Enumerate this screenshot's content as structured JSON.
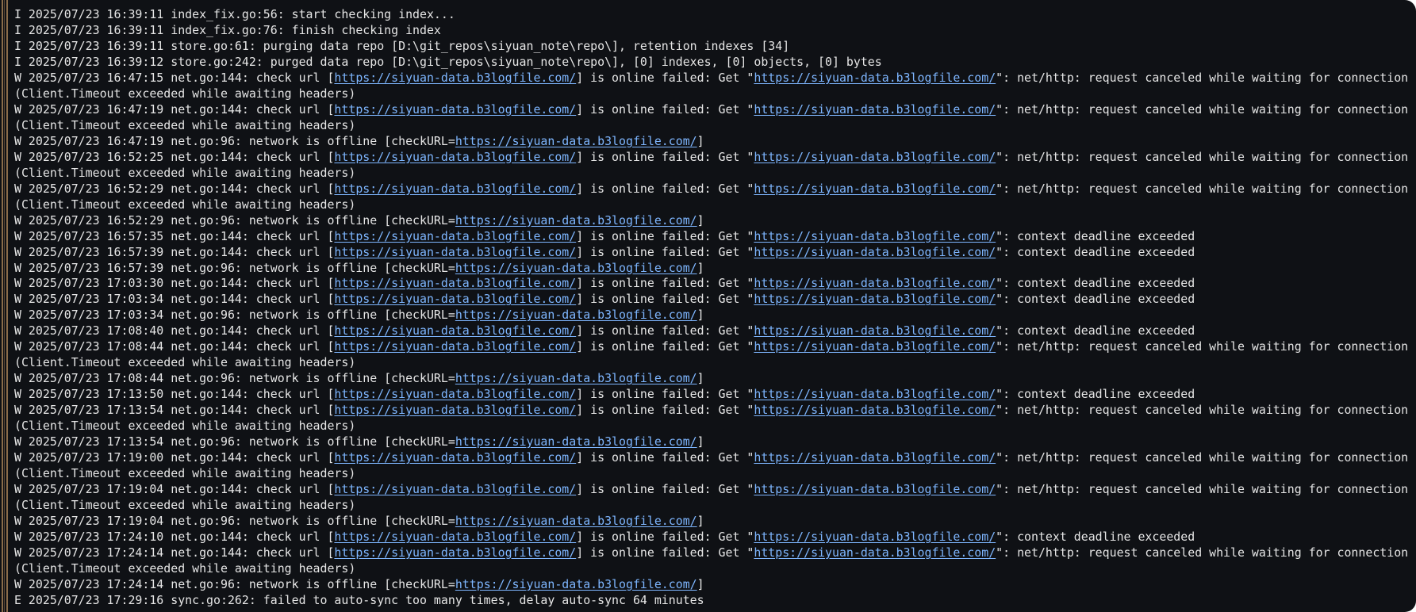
{
  "terminal": {
    "lines": [
      [
        "I 2025/07/23 16:39:11 index_fix.go:56: start checking index..."
      ],
      [
        "I 2025/07/23 16:39:11 index_fix.go:76: finish checking index"
      ],
      [
        "I 2025/07/23 16:39:11 store.go:61: purging data repo [D:\\git_repos\\siyuan_note\\repo\\], retention indexes [34]"
      ],
      [
        "I 2025/07/23 16:39:12 store.go:242: purged data repo [D:\\git_repos\\siyuan_note\\repo\\], [0] indexes, [0] objects, [0] bytes"
      ],
      [
        "W 2025/07/23 16:47:15 net.go:144: check url [",
        {
          "url": "https://siyuan-data.b3logfile.com/"
        },
        "] is online failed: Get \"",
        {
          "url": "https://siyuan-data.b3logfile.com/"
        },
        "\": net/http: request canceled while waiting for connection"
      ],
      [
        "(Client.Timeout exceeded while awaiting headers)"
      ],
      [
        "W 2025/07/23 16:47:19 net.go:144: check url [",
        {
          "url": "https://siyuan-data.b3logfile.com/"
        },
        "] is online failed: Get \"",
        {
          "url": "https://siyuan-data.b3logfile.com/"
        },
        "\": net/http: request canceled while waiting for connection"
      ],
      [
        "(Client.Timeout exceeded while awaiting headers)"
      ],
      [
        "W 2025/07/23 16:47:19 net.go:96: network is offline [checkURL=",
        {
          "url": "https://siyuan-data.b3logfile.com/"
        },
        "]"
      ],
      [
        "W 2025/07/23 16:52:25 net.go:144: check url [",
        {
          "url": "https://siyuan-data.b3logfile.com/"
        },
        "] is online failed: Get \"",
        {
          "url": "https://siyuan-data.b3logfile.com/"
        },
        "\": net/http: request canceled while waiting for connection"
      ],
      [
        "(Client.Timeout exceeded while awaiting headers)"
      ],
      [
        "W 2025/07/23 16:52:29 net.go:144: check url [",
        {
          "url": "https://siyuan-data.b3logfile.com/"
        },
        "] is online failed: Get \"",
        {
          "url": "https://siyuan-data.b3logfile.com/"
        },
        "\": net/http: request canceled while waiting for connection"
      ],
      [
        "(Client.Timeout exceeded while awaiting headers)"
      ],
      [
        "W 2025/07/23 16:52:29 net.go:96: network is offline [checkURL=",
        {
          "url": "https://siyuan-data.b3logfile.com/"
        },
        "]"
      ],
      [
        "W 2025/07/23 16:57:35 net.go:144: check url [",
        {
          "url": "https://siyuan-data.b3logfile.com/"
        },
        "] is online failed: Get \"",
        {
          "url": "https://siyuan-data.b3logfile.com/"
        },
        "\": context deadline exceeded"
      ],
      [
        "W 2025/07/23 16:57:39 net.go:144: check url [",
        {
          "url": "https://siyuan-data.b3logfile.com/"
        },
        "] is online failed: Get \"",
        {
          "url": "https://siyuan-data.b3logfile.com/"
        },
        "\": context deadline exceeded"
      ],
      [
        "W 2025/07/23 16:57:39 net.go:96: network is offline [checkURL=",
        {
          "url": "https://siyuan-data.b3logfile.com/"
        },
        "]"
      ],
      [
        "W 2025/07/23 17:03:30 net.go:144: check url [",
        {
          "url": "https://siyuan-data.b3logfile.com/"
        },
        "] is online failed: Get \"",
        {
          "url": "https://siyuan-data.b3logfile.com/"
        },
        "\": context deadline exceeded"
      ],
      [
        "W 2025/07/23 17:03:34 net.go:144: check url [",
        {
          "url": "https://siyuan-data.b3logfile.com/"
        },
        "] is online failed: Get \"",
        {
          "url": "https://siyuan-data.b3logfile.com/"
        },
        "\": context deadline exceeded"
      ],
      [
        "W 2025/07/23 17:03:34 net.go:96: network is offline [checkURL=",
        {
          "url": "https://siyuan-data.b3logfile.com/"
        },
        "]"
      ],
      [
        "W 2025/07/23 17:08:40 net.go:144: check url [",
        {
          "url": "https://siyuan-data.b3logfile.com/"
        },
        "] is online failed: Get \"",
        {
          "url": "https://siyuan-data.b3logfile.com/"
        },
        "\": context deadline exceeded"
      ],
      [
        "W 2025/07/23 17:08:44 net.go:144: check url [",
        {
          "url": "https://siyuan-data.b3logfile.com/"
        },
        "] is online failed: Get \"",
        {
          "url": "https://siyuan-data.b3logfile.com/"
        },
        "\": net/http: request canceled while waiting for connection"
      ],
      [
        "(Client.Timeout exceeded while awaiting headers)"
      ],
      [
        "W 2025/07/23 17:08:44 net.go:96: network is offline [checkURL=",
        {
          "url": "https://siyuan-data.b3logfile.com/"
        },
        "]"
      ],
      [
        "W 2025/07/23 17:13:50 net.go:144: check url [",
        {
          "url": "https://siyuan-data.b3logfile.com/"
        },
        "] is online failed: Get \"",
        {
          "url": "https://siyuan-data.b3logfile.com/"
        },
        "\": context deadline exceeded"
      ],
      [
        "W 2025/07/23 17:13:54 net.go:144: check url [",
        {
          "url": "https://siyuan-data.b3logfile.com/"
        },
        "] is online failed: Get \"",
        {
          "url": "https://siyuan-data.b3logfile.com/"
        },
        "\": net/http: request canceled while waiting for connection"
      ],
      [
        "(Client.Timeout exceeded while awaiting headers)"
      ],
      [
        "W 2025/07/23 17:13:54 net.go:96: network is offline [checkURL=",
        {
          "url": "https://siyuan-data.b3logfile.com/"
        },
        "]"
      ],
      [
        "W 2025/07/23 17:19:00 net.go:144: check url [",
        {
          "url": "https://siyuan-data.b3logfile.com/"
        },
        "] is online failed: Get \"",
        {
          "url": "https://siyuan-data.b3logfile.com/"
        },
        "\": net/http: request canceled while waiting for connection"
      ],
      [
        "(Client.Timeout exceeded while awaiting headers)"
      ],
      [
        "W 2025/07/23 17:19:04 net.go:144: check url [",
        {
          "url": "https://siyuan-data.b3logfile.com/"
        },
        "] is online failed: Get \"",
        {
          "url": "https://siyuan-data.b3logfile.com/"
        },
        "\": net/http: request canceled while waiting for connection"
      ],
      [
        "(Client.Timeout exceeded while awaiting headers)"
      ],
      [
        "W 2025/07/23 17:19:04 net.go:96: network is offline [checkURL=",
        {
          "url": "https://siyuan-data.b3logfile.com/"
        },
        "]"
      ],
      [
        "W 2025/07/23 17:24:10 net.go:144: check url [",
        {
          "url": "https://siyuan-data.b3logfile.com/"
        },
        "] is online failed: Get \"",
        {
          "url": "https://siyuan-data.b3logfile.com/"
        },
        "\": context deadline exceeded"
      ],
      [
        "W 2025/07/23 17:24:14 net.go:144: check url [",
        {
          "url": "https://siyuan-data.b3logfile.com/"
        },
        "] is online failed: Get \"",
        {
          "url": "https://siyuan-data.b3logfile.com/"
        },
        "\": net/http: request canceled while waiting for connection"
      ],
      [
        "(Client.Timeout exceeded while awaiting headers)"
      ],
      [
        "W 2025/07/23 17:24:14 net.go:96: network is offline [checkURL=",
        {
          "url": "https://siyuan-data.b3logfile.com/"
        },
        "]"
      ],
      [
        "E 2025/07/23 17:29:16 sync.go:262: failed to auto-sync too many times, delay auto-sync 64 minutes"
      ]
    ]
  },
  "colors": {
    "background": "#0f1115",
    "text": "#e6e6e6",
    "link": "#7eb6ff",
    "border_accent": "#8b6c4a"
  }
}
